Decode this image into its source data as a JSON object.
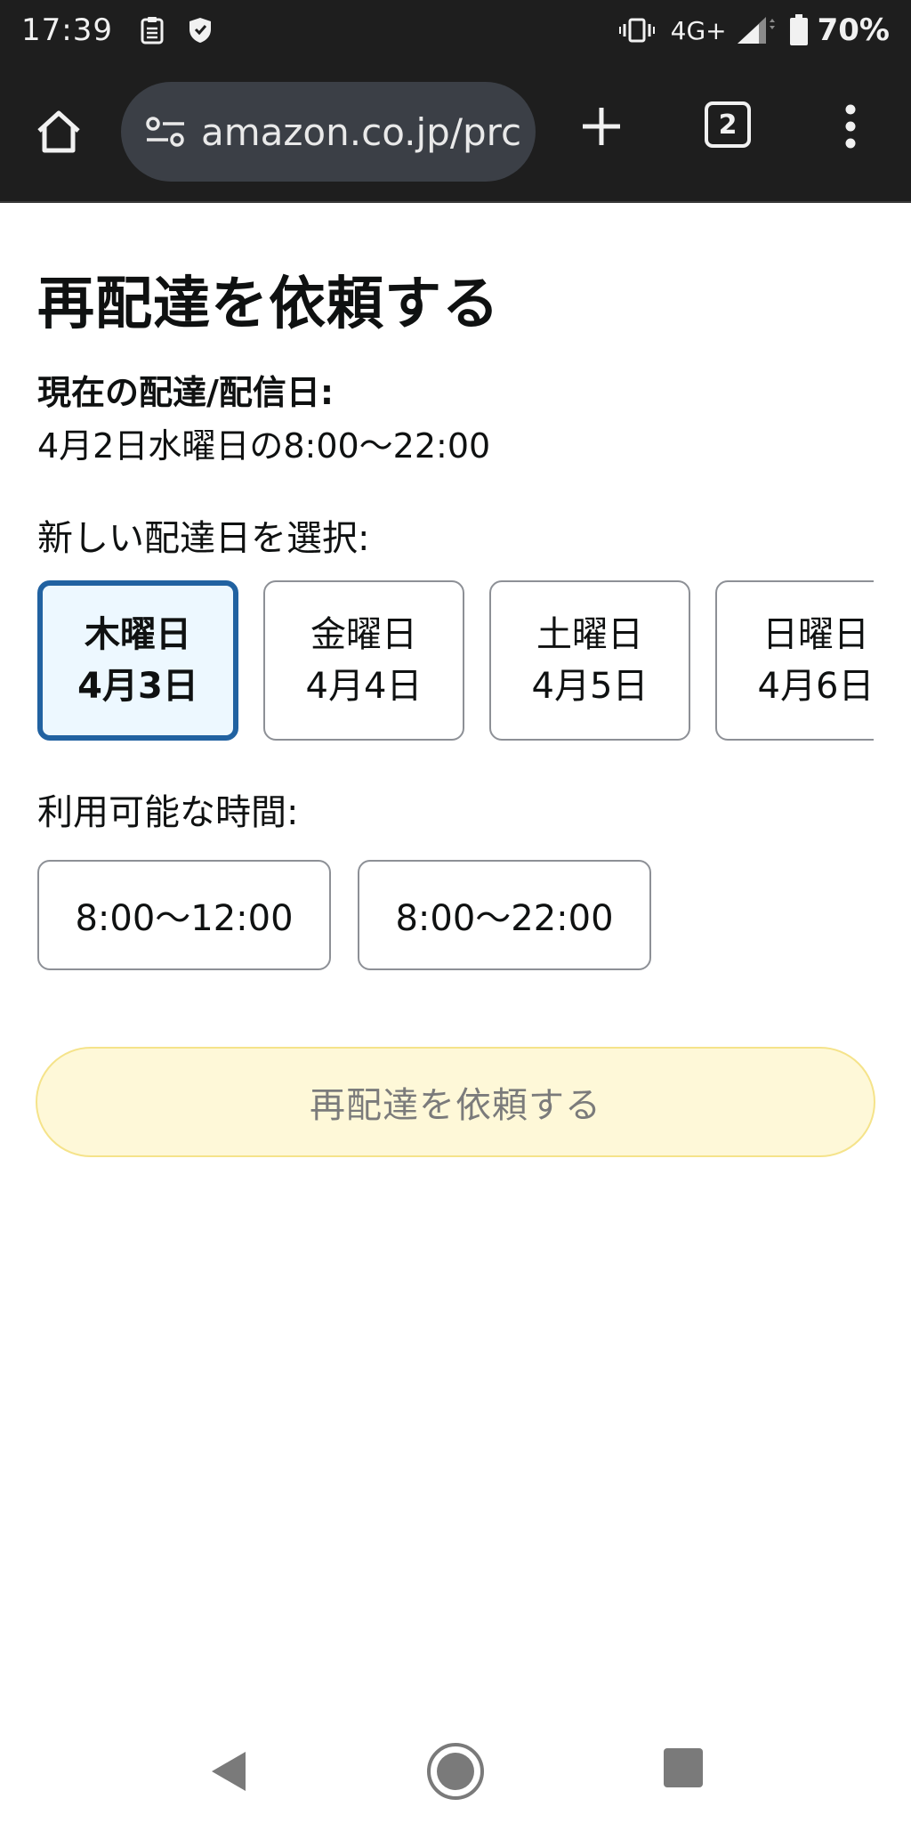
{
  "status_bar": {
    "time": "17:39",
    "network": "4G+",
    "battery": "70%"
  },
  "browser": {
    "url": "amazon.co.jp/prc",
    "tab_count": "2"
  },
  "page": {
    "title": "再配達を依頼する",
    "current_delivery_label": "現在の配達/配信日:",
    "current_delivery_value": "4月2日水曜日の8:00〜22:00",
    "select_date_label": "新しい配達日を選択:",
    "dates": [
      {
        "day": "木曜日",
        "date": "4月3日",
        "selected": true
      },
      {
        "day": "金曜日",
        "date": "4月4日",
        "selected": false
      },
      {
        "day": "土曜日",
        "date": "4月5日",
        "selected": false
      },
      {
        "day": "日曜日",
        "date": "4月6日",
        "selected": false
      }
    ],
    "time_label": "利用可能な時間:",
    "time_slots": [
      "8:00〜12:00",
      "8:00〜22:00"
    ],
    "submit_label": "再配達を依頼する"
  },
  "colors": {
    "selected_border": "#2162a1",
    "selected_bg": "#edf8ff",
    "submit_bg": "#fef8d8",
    "submit_border": "#f5e38a"
  }
}
